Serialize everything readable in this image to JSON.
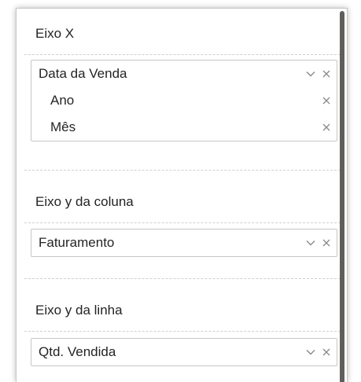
{
  "fields_pane": {
    "sections": [
      {
        "title": "Eixo X",
        "field": "Data da Venda",
        "sub_fields": [
          "Ano",
          "Mês"
        ]
      },
      {
        "title": "Eixo y da coluna",
        "field": "Faturamento"
      },
      {
        "title": "Eixo y da linha",
        "field": "Qtd. Vendida"
      }
    ]
  },
  "icons": {
    "expand": "chevron-down-icon",
    "remove": "close-icon"
  },
  "colors": {
    "text": "#252423",
    "icon": "#8a8886",
    "border": "#c8c6c4",
    "scrollbar": "#605e5c"
  }
}
